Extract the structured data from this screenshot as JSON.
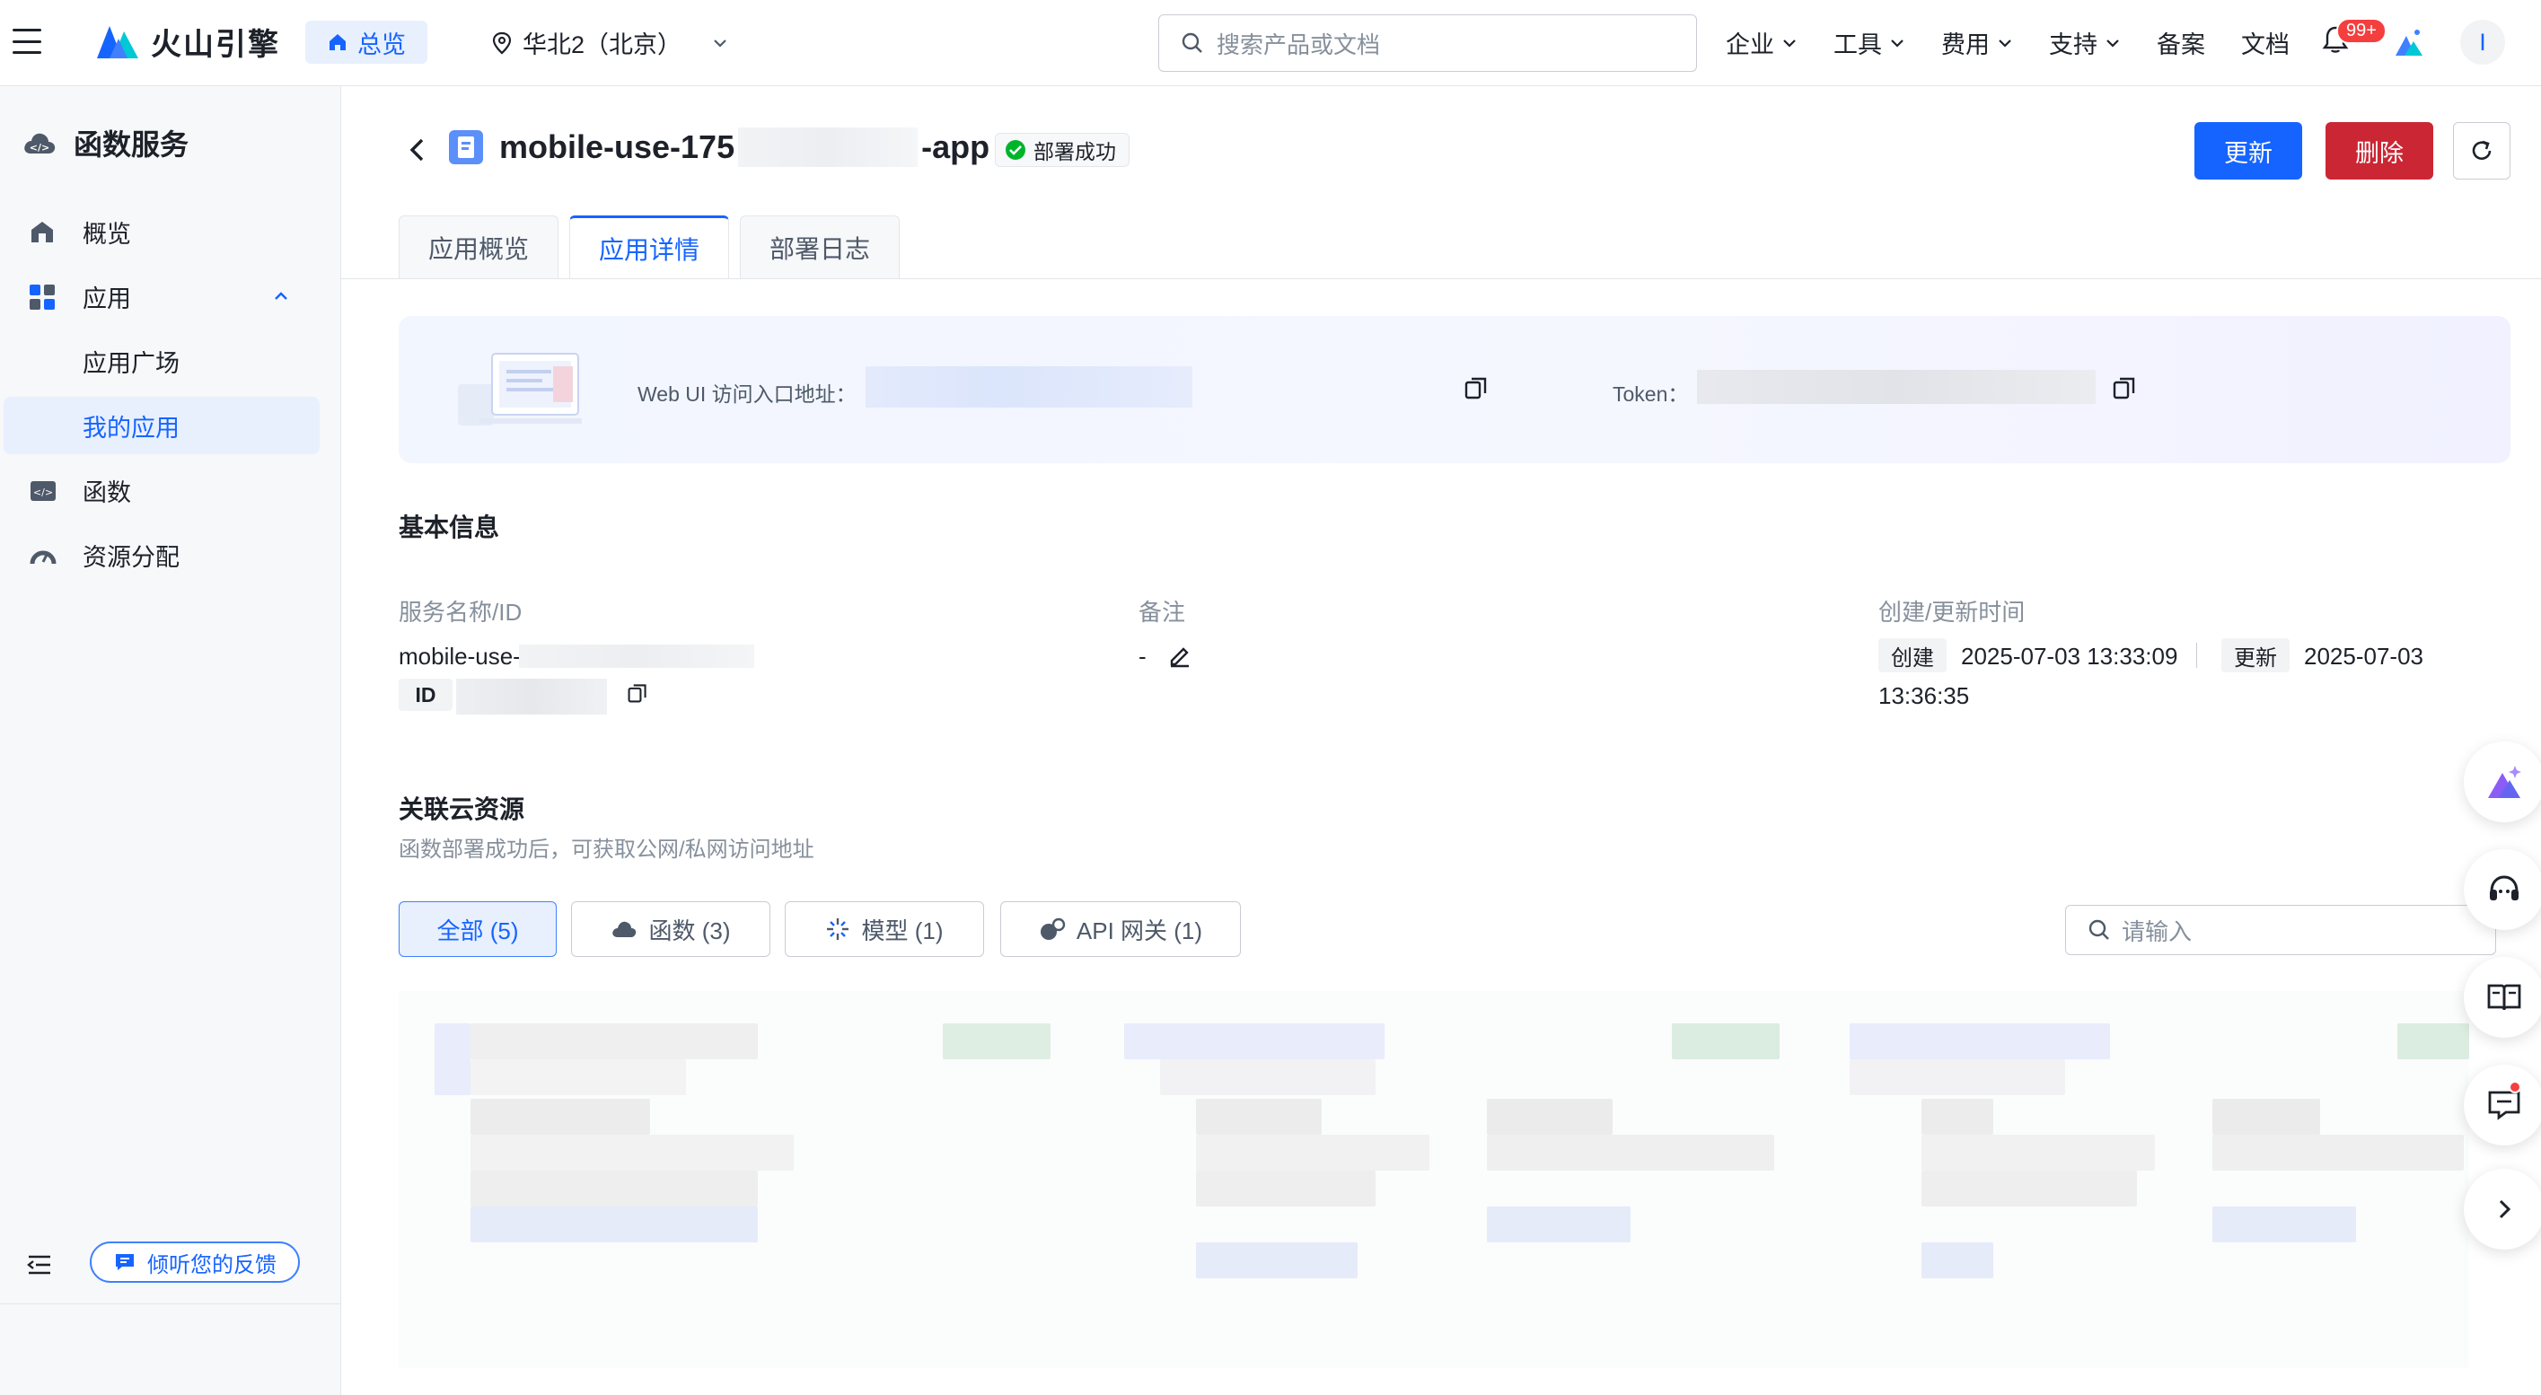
{
  "header": {
    "brand": "火山引擎",
    "overview_label": "总览",
    "region": "华北2（北京）",
    "search_placeholder": "搜索产品或文档",
    "nav": [
      "企业",
      "工具",
      "费用",
      "支持",
      "备案",
      "文档"
    ],
    "notification_count": "99+",
    "user_initial": "I",
    "colors": {
      "brand": "#1664ff"
    }
  },
  "sidebar": {
    "title": "函数服务",
    "items": [
      {
        "label": "概览",
        "icon": "dashboard-icon"
      },
      {
        "label": "应用",
        "icon": "apps-icon",
        "expanded": true
      },
      {
        "label": "应用广场",
        "sub": true
      },
      {
        "label": "我的应用",
        "sub": true,
        "active": true
      },
      {
        "label": "函数",
        "icon": "code-icon"
      },
      {
        "label": "资源分配",
        "icon": "gauge-icon"
      }
    ],
    "feedback_label": "倾听您的反馈"
  },
  "page": {
    "title_prefix": "mobile-use-175",
    "title_suffix": "-app",
    "status": "部署成功",
    "update_button": "更新",
    "delete_button": "删除",
    "tabs": [
      "应用概览",
      "应用详情",
      "部署日志"
    ],
    "active_tab": "应用详情"
  },
  "banner": {
    "webui_label": "Web UI 访问入口地址：",
    "token_label": "Token："
  },
  "basic_info": {
    "title": "基本信息",
    "service_label": "服务名称/ID",
    "service_name": "mobile-use-",
    "id_tag": "ID",
    "remark_label": "备注",
    "remark_value": "-",
    "time_label": "创建/更新时间",
    "created_tag": "创建",
    "created_time": "2025-07-03 13:33:09",
    "updated_tag": "更新",
    "updated_time_date": "2025-07-03",
    "updated_time_clock": "13:36:35"
  },
  "resources": {
    "title": "关联云资源",
    "subtitle": "函数部署成功后，可获取公网/私网访问地址",
    "filters": [
      {
        "label": "全部 (5)",
        "icon": ""
      },
      {
        "label": "函数 (3)",
        "icon": "cloud-icon"
      },
      {
        "label": "模型 (1)",
        "icon": "sparkle-icon"
      },
      {
        "label": "API 网关 (1)",
        "icon": "gateway-icon"
      }
    ],
    "search_placeholder": "请输入"
  }
}
